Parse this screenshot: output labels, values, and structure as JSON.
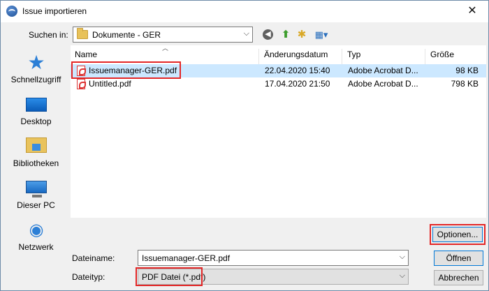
{
  "window": {
    "title": "Issue importieren",
    "close_label": "✕"
  },
  "toolbar": {
    "look_in_label": "Suchen in:",
    "look_in_value": "Dokumente - GER",
    "icons": [
      "back-icon",
      "up-folder-icon",
      "new-folder-icon",
      "view-menu-icon"
    ]
  },
  "places": [
    {
      "label": "Schnellzugriff",
      "icon": "star-icon"
    },
    {
      "label": "Desktop",
      "icon": "desktop-icon"
    },
    {
      "label": "Bibliotheken",
      "icon": "libraries-icon"
    },
    {
      "label": "Dieser PC",
      "icon": "computer-icon"
    },
    {
      "label": "Netzwerk",
      "icon": "network-icon"
    }
  ],
  "columns": {
    "name": "Name",
    "date": "Änderungsdatum",
    "type": "Typ",
    "size": "Größe"
  },
  "files": [
    {
      "name": "Issuemanager-GER.pdf",
      "date": "22.04.2020 15:40",
      "type": "Adobe Acrobat D...",
      "size": "98 KB",
      "selected": true
    },
    {
      "name": "Untitled.pdf",
      "date": "17.04.2020 21:50",
      "type": "Adobe Acrobat D...",
      "size": "798 KB",
      "selected": false
    }
  ],
  "options_button": "Optionen...",
  "filename": {
    "label": "Dateiname:",
    "value": "Issuemanager-GER.pdf"
  },
  "filetype": {
    "label": "Dateityp:",
    "value": "PDF Datei (*.pdf)"
  },
  "buttons": {
    "open": "Öffnen",
    "cancel": "Abbrechen"
  },
  "colors": {
    "selection": "#cce8ff",
    "highlight": "#e32626",
    "accent": "#0078d7"
  }
}
